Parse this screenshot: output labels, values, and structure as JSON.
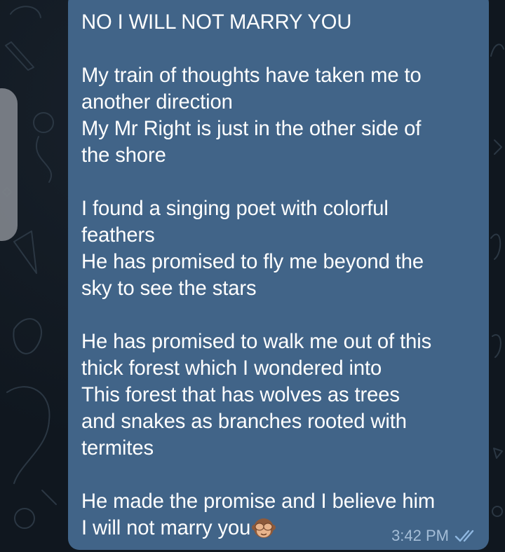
{
  "chat": {
    "message": {
      "title_line": "NO I WILL NOT MARRY YOU",
      "body_lines": "My train of thoughts have taken me to\nanother direction\nMy Mr Right is just in the other side of\nthe shore\n\nI found a singing poet with colorful\nfeathers\nHe has promised to fly me beyond the\nsky to see the stars\n\nHe has promised to walk me out of this\nthick forest which I wondered into\nThis forest that has wolves as trees\nand snakes as branches rooted with\ntermites\n\nHe made the promise and I believe him",
      "last_line": "I will not marry you",
      "emoji": "see-no-evil-monkey-icon",
      "time": "3:42 PM",
      "status": "read-double-check-icon"
    }
  },
  "colors": {
    "bubble": "#416488",
    "background": "#10171f",
    "time": "#a4bdd7",
    "check": "#8fb7e0"
  }
}
